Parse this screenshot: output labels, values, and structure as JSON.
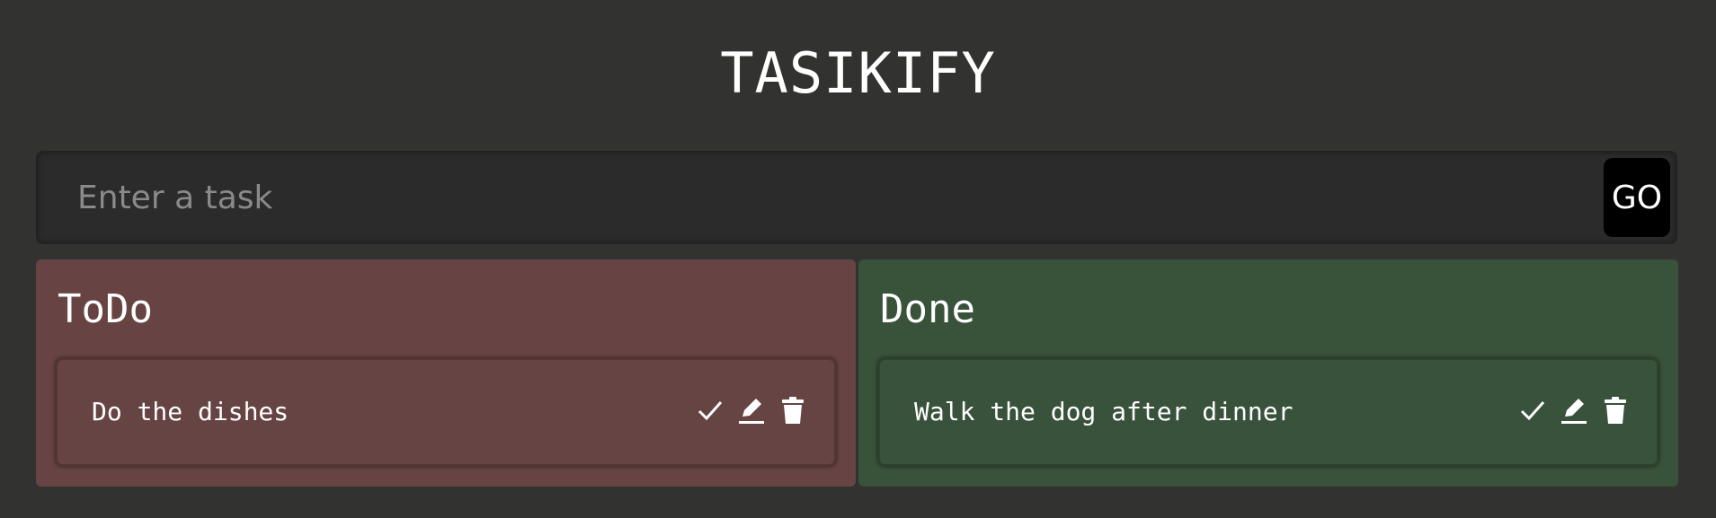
{
  "app": {
    "title": "TASIKIFY"
  },
  "form": {
    "placeholder": "Enter a task",
    "value": "",
    "go_label": "GO"
  },
  "todo": {
    "heading": "ToDo",
    "tasks": [
      {
        "text": "Do the dishes"
      }
    ]
  },
  "done": {
    "heading": "Done",
    "tasks": [
      {
        "text": "Walk the dog after dinner"
      }
    ]
  },
  "icons": {
    "complete": "check-icon",
    "edit": "pencil-icon",
    "delete": "trash-icon"
  },
  "colors": {
    "background": "#323230",
    "todo_panel": "#674443",
    "done_panel": "#39523a",
    "go_button": "#000000",
    "text": "#ffffff",
    "placeholder": "#8a8a8a"
  }
}
